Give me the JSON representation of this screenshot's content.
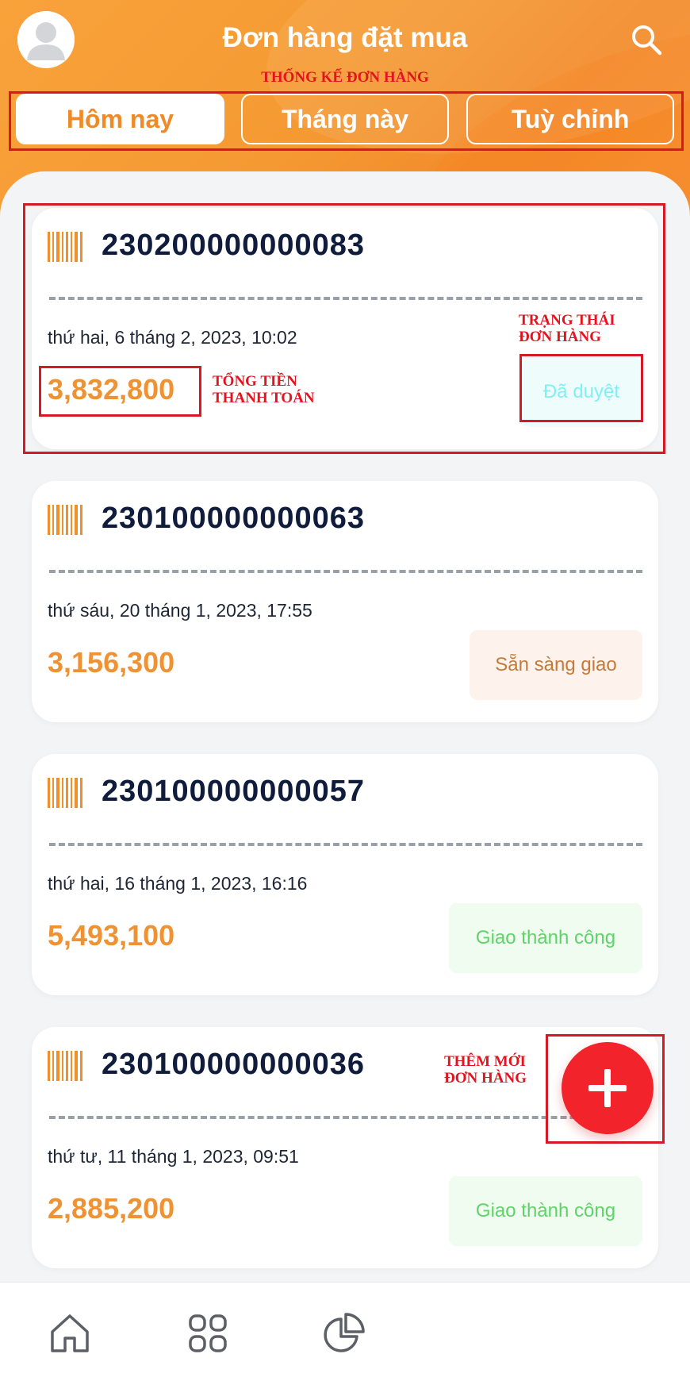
{
  "header": {
    "title": "Đơn hàng đặt mua",
    "avatar_icon": "user-avatar-icon",
    "search_icon": "search-icon"
  },
  "annotations": {
    "tabs_label": "THỐNG KẾ ĐƠN HÀNG",
    "status_label_1": "TRẠNG THÁI",
    "status_label_2": "ĐƠN HÀNG",
    "total_label_1": "TỔNG TIỀN",
    "total_label_2": "THANH TOÁN",
    "add_label_1": "THÊM MỚI",
    "add_label_2": "ĐƠN HÀNG"
  },
  "tabs": [
    {
      "label": "Hôm nay",
      "active": true
    },
    {
      "label": "Tháng này",
      "active": false
    },
    {
      "label": "Tuỳ chỉnh",
      "active": false
    }
  ],
  "orders": [
    {
      "id": "230200000000083",
      "date": "thứ hai, 6 tháng 2, 2023, 10:02",
      "total": "3,832,800",
      "status": "Đã duyệt",
      "status_color": "#7ff0f6",
      "status_bg": "#effcfc"
    },
    {
      "id": "230100000000063",
      "date": "thứ sáu, 20 tháng 1, 2023, 17:55",
      "total": "3,156,300",
      "status": "Sẵn sàng giao",
      "status_color": "#c47a3a",
      "status_bg": "#fdf3ec"
    },
    {
      "id": "230100000000057",
      "date": "thứ hai, 16 tháng 1, 2023, 16:16",
      "total": "5,493,100",
      "status": "Giao thành công",
      "status_color": "#5fd36a",
      "status_bg": "#effcef"
    },
    {
      "id": "230100000000036",
      "date": "thứ tư, 11 tháng 1, 2023, 09:51",
      "total": "2,885,200",
      "status": "Giao thành công",
      "status_color": "#5fd36a",
      "status_bg": "#effcef"
    }
  ],
  "fab": {
    "icon": "plus-icon",
    "color": "#f2232a"
  },
  "bottom_nav": [
    {
      "icon": "home-icon"
    },
    {
      "icon": "grid-icon"
    },
    {
      "icon": "pie-chart-icon"
    }
  ],
  "colors": {
    "accent": "#f59a33",
    "annotation": "#e3141e",
    "amount": "#ef9234",
    "order_id": "#0f1c3c"
  }
}
